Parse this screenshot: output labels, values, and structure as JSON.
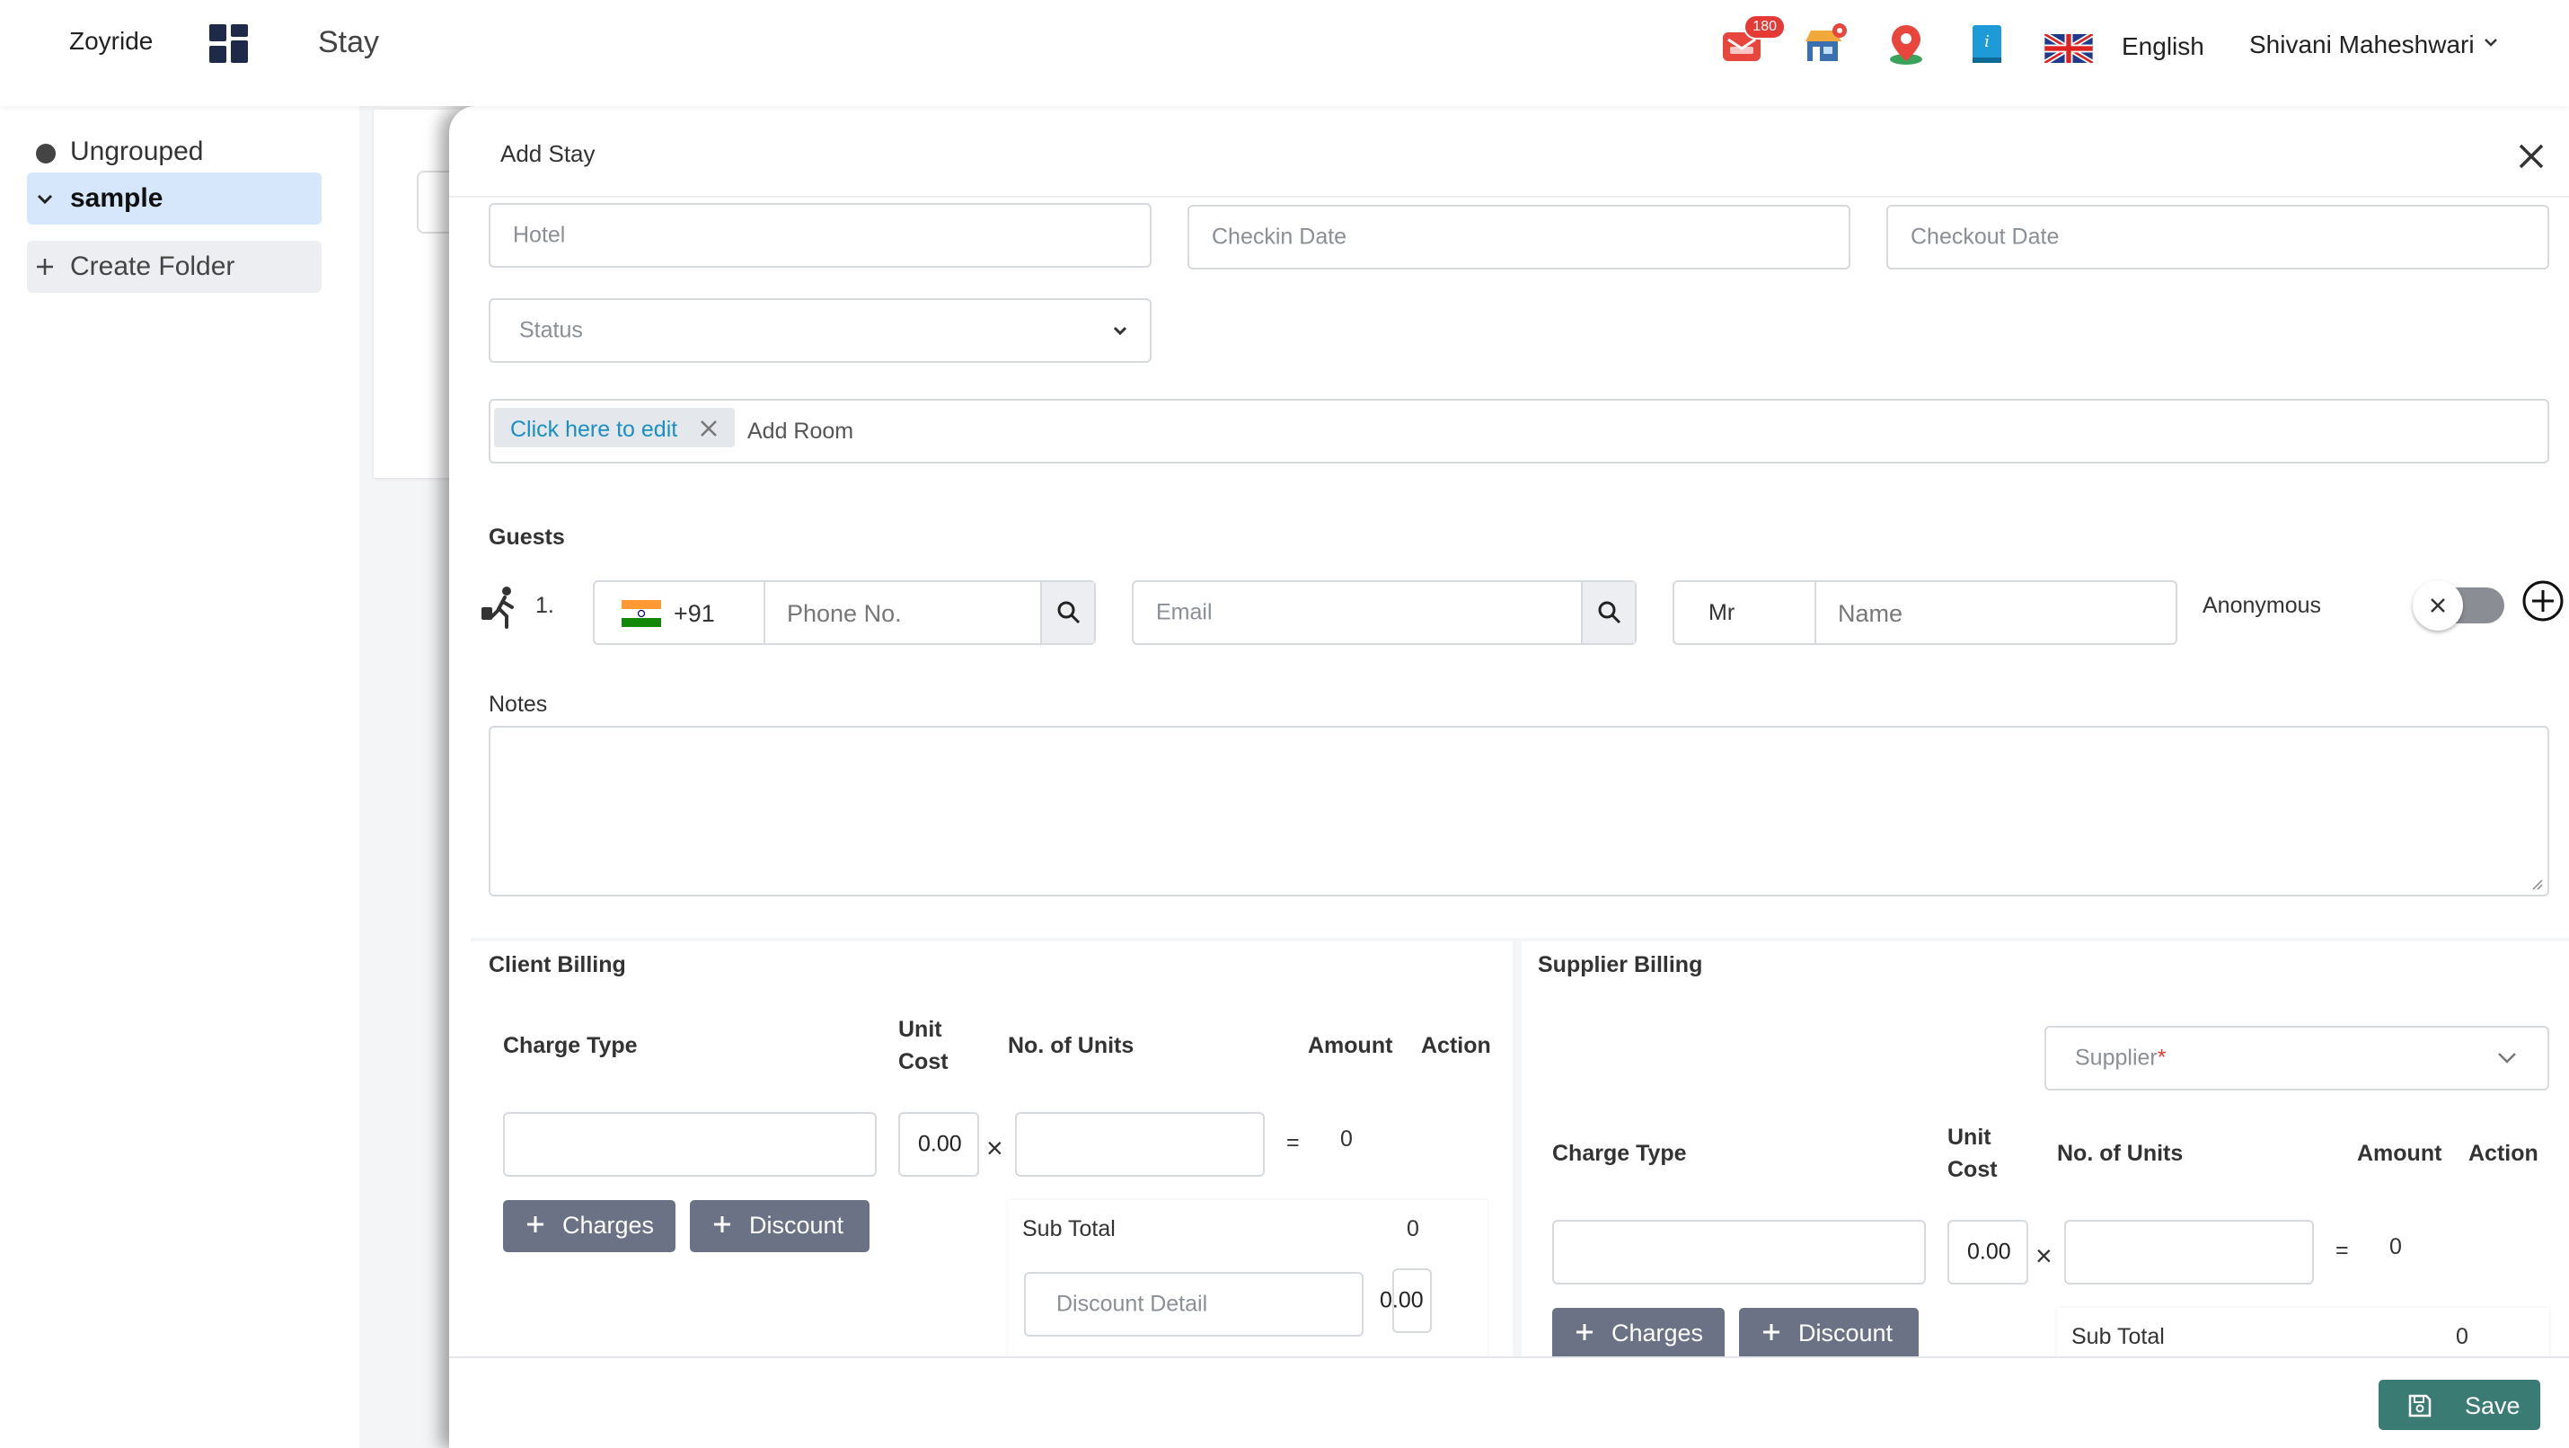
{
  "topbar": {
    "brand": "Zoyride",
    "title": "Stay",
    "badge_count": "180",
    "language": "English",
    "user_name": "Shivani Maheshwari"
  },
  "sidebar": {
    "items": [
      {
        "label": "Ungrouped"
      },
      {
        "label": "sample"
      },
      {
        "label": "Create Folder"
      }
    ]
  },
  "modal": {
    "title": "Add Stay",
    "hotel_placeholder": "Hotel",
    "checkin_placeholder": "Checkin Date",
    "checkout_placeholder": "Checkout Date",
    "status_placeholder": "Status",
    "room_tag": "Click here to edit",
    "add_room_placeholder": "Add Room",
    "guests_label": "Guests",
    "guest_index": "1.",
    "country_code": "+91",
    "phone_placeholder": "Phone No.",
    "email_placeholder": "Email",
    "salutation": "Mr",
    "name_placeholder": "Name",
    "anonymous_label": "Anonymous",
    "notes_label": "Notes"
  },
  "client_billing": {
    "title": "Client Billing",
    "col_charge_type": "Charge Type",
    "col_unit_cost_1": "Unit",
    "col_unit_cost_2": "Cost",
    "col_units": "No. of Units",
    "col_amount": "Amount",
    "col_action": "Action",
    "unit_cost": "0.00",
    "times": "×",
    "equals": "=",
    "amount": "0",
    "charges_btn": "Charges",
    "discount_btn": "Discount",
    "subtotal_label": "Sub Total",
    "subtotal_value": "0",
    "discount_detail_placeholder": "Discount Detail",
    "discount_value": "0.00"
  },
  "supplier_billing": {
    "title": "Supplier Billing",
    "supplier_placeholder": "Supplier",
    "required_mark": "*",
    "col_charge_type": "Charge Type",
    "col_unit_cost_1": "Unit",
    "col_unit_cost_2": "Cost",
    "col_units": "No. of Units",
    "col_amount": "Amount",
    "col_action": "Action",
    "unit_cost": "0.00",
    "times": "×",
    "equals": "=",
    "amount": "0",
    "charges_btn": "Charges",
    "discount_btn": "Discount",
    "subtotal_label": "Sub Total",
    "subtotal_value": "0"
  },
  "footer": {
    "save_label": "Save"
  },
  "colors": {
    "save_button": "#3a7c74",
    "grey_button": "#6b7285",
    "tag_link": "#1a8fc4",
    "badge": "#e53935",
    "sidebar_selected": "#d6e6fb"
  }
}
